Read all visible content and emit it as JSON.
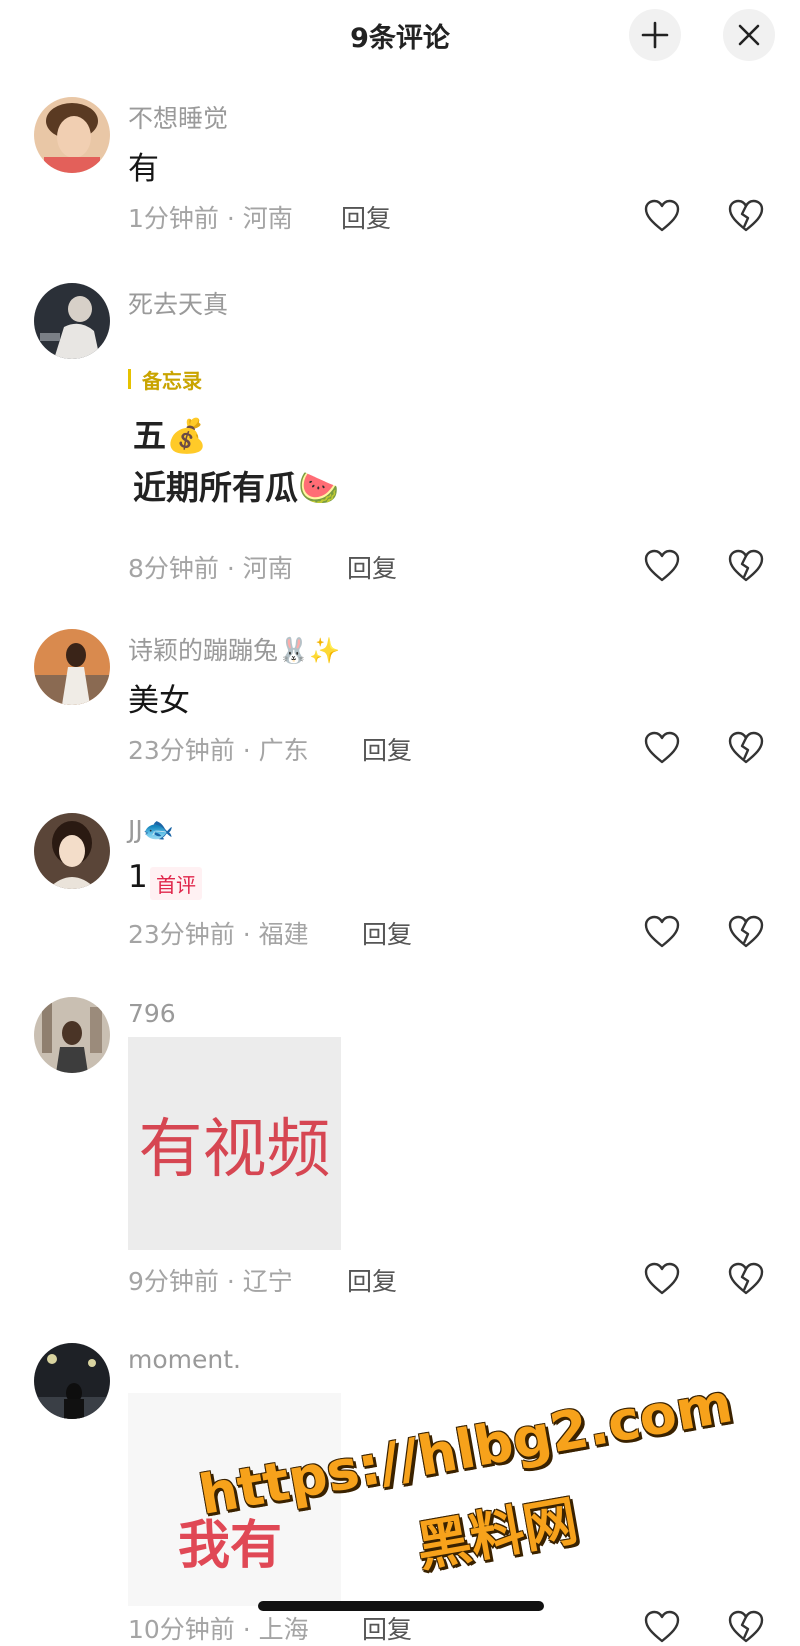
{
  "header": {
    "title": "9条评论",
    "collapse_icon": "collapse-icon",
    "close_icon": "close-icon"
  },
  "comments": [
    {
      "username": "不想睡觉",
      "text": "有",
      "time_location": "1分钟前 · 河南",
      "reply": "回复"
    },
    {
      "username": "死去天真",
      "memo_tag": "备忘录",
      "memo_lines": [
        "五💰",
        "近期所有瓜🍉"
      ],
      "time_location": "8分钟前 · 河南",
      "reply": "回复"
    },
    {
      "username": "诗颖的蹦蹦兔🐰✨",
      "text": "美女",
      "time_location": "23分钟前 · 广东",
      "reply": "回复"
    },
    {
      "username": "JJ🐟",
      "text": "1",
      "badge": "首评",
      "time_location": "23分钟前 · 福建",
      "reply": "回复"
    },
    {
      "username": "796",
      "image_text": "有视频",
      "time_location": "9分钟前 · 辽宁",
      "reply": "回复"
    },
    {
      "username": "moment.",
      "image_text": "我有",
      "time_location": "10分钟前 · 上海",
      "reply": "回复"
    }
  ],
  "watermark": {
    "url": "https://hlbg2.com",
    "name": "黑料网"
  },
  "colors": {
    "accent_memo": "#c9a400",
    "badge_red": "#e0264b",
    "watermark_orange": "#f7a21b"
  }
}
